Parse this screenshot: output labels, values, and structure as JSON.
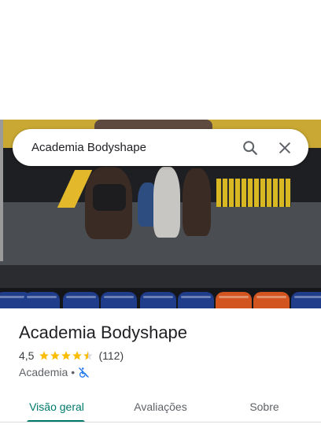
{
  "search": {
    "query": "Academia Bodyshape"
  },
  "place": {
    "name": "Academia Bodyshape",
    "rating": "4,5",
    "stars": 4.5,
    "review_count": "(112)",
    "category": "Academia",
    "separator": "•",
    "accessibility_icon": "not-wheelchair-accessible-icon"
  },
  "tabs": [
    {
      "label": "Visão geral",
      "active": true
    },
    {
      "label": "Avaliações",
      "active": false
    },
    {
      "label": "Sobre",
      "active": false
    }
  ],
  "colors": {
    "accent": "#00796b",
    "star": "#fbbc04",
    "accessibility": "#1a73e8"
  },
  "icons": {
    "search": "search-icon",
    "close": "close-icon"
  }
}
